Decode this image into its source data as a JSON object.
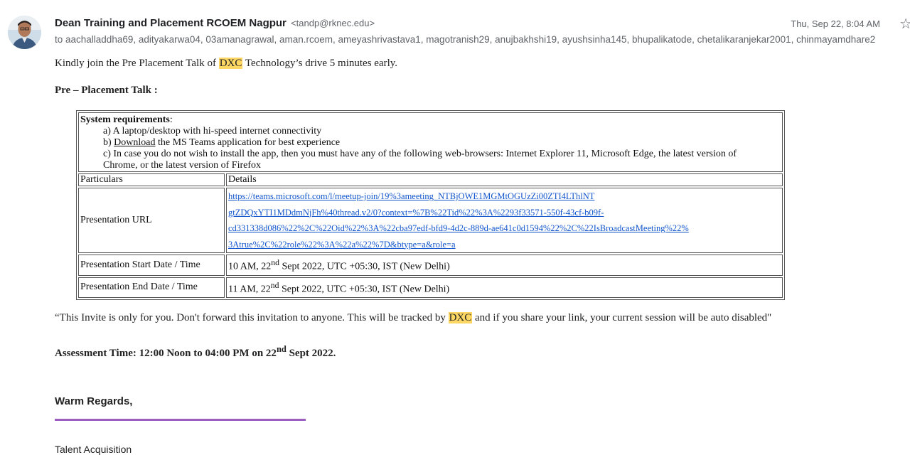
{
  "email": {
    "sender_name": "Dean Training and Placement RCOEM Nagpur",
    "sender_email": "<tandp@rknec.edu>",
    "date": "Thu, Sep 22, 8:04 AM",
    "to_line": "to aachalladdha69, adityakarwa04, 03amanagrawal, aman.rcoem, ameyashrivastava1, magotranish29, anujbakhshi19, ayushsinha145, bhupalikatode, chetalikaranjekar2001, chinmayamdhare2"
  },
  "body": {
    "intro_a": "Kindly join the Pre Placement Talk of ",
    "company": "DXC",
    "intro_b": " Technology’s drive 5 minutes early.",
    "section_title": "Pre – Placement Talk :",
    "sysreq_title": "System requirements",
    "sysreq_a": "a) A laptop/desktop with hi-speed internet connectivity",
    "sysreq_b_prefix": "b) ",
    "sysreq_b_link": "Download",
    "sysreq_b_rest": " the MS Teams application for best experience",
    "sysreq_c": "c) In case you do not wish to install the app, then you must have any of the following web-browsers: Internet Explorer 11, Microsoft Edge, the latest version of Chrome, or the latest version of Firefox",
    "table": {
      "header_particulars": "Particulars",
      "header_details": "Details",
      "url_label": "Presentation URL",
      "url_lines": [
        "https://teams.microsoft.com/l/meetup-join/19%3ameeting_NTBjOWE1MGMtOGUzZi00ZTI4LThlNT",
        "gtZDQxYTI1MDdmNjFh%40thread.v2/0?context=%7B%22Tid%22%3A%2293f33571-550f-43cf-b09f-",
        "cd331338d086%22%2C%22Oid%22%3A%22cba97edf-bfd9-4d2c-889d-ae641c0d1594%22%2C%22IsBroadcastMeeting%22%",
        "3Atrue%2C%22role%22%3A%22a%22%7D&btype=a&role=a"
      ],
      "start_label": "Presentation Start Date / Time",
      "start_a": "10 AM, 22",
      "start_sup": "nd",
      "start_b": " Sept 2022, UTC +05:30, IST (New Delhi)",
      "end_label": "Presentation End Date / Time",
      "end_a": "11 AM, 22",
      "end_sup": "nd",
      "end_b": " Sept 2022, UTC +05:30, IST (New Delhi)"
    },
    "notice_a": "“This Invite is only for you. Don't forward this invitation to anyone. This will be tracked by ",
    "notice_company": "DXC",
    "notice_b": " and if you share your link, your current session will be auto disabled\"",
    "assessment_a": "Assessment Time: 12:00 Noon to 04:00 PM on 22",
    "assessment_sup": "nd",
    "assessment_b": "  Sept 2022.",
    "regards": "Warm Regards,",
    "signature": "Talent Acquisition"
  },
  "icons": {
    "star": "star-icon",
    "avatar": "avatar"
  },
  "colors": {
    "highlight": "#fdd663",
    "link": "#1155cc",
    "divider": "#9d5fbf"
  }
}
